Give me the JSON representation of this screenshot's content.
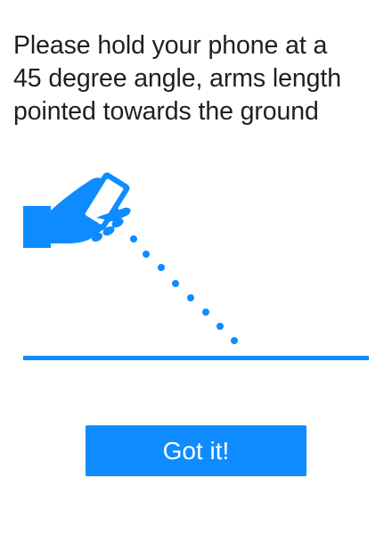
{
  "instruction": {
    "line1": "Please hold your phone at a",
    "line2": "45 degree angle, arms length",
    "line3": "pointed towards the ground"
  },
  "illustration": {
    "icons": [
      "hand-holding-phone-icon",
      "dotted-trajectory",
      "ground-line"
    ],
    "accent_color": "#0e8cff"
  },
  "actions": {
    "confirm_label": "Got it!"
  }
}
